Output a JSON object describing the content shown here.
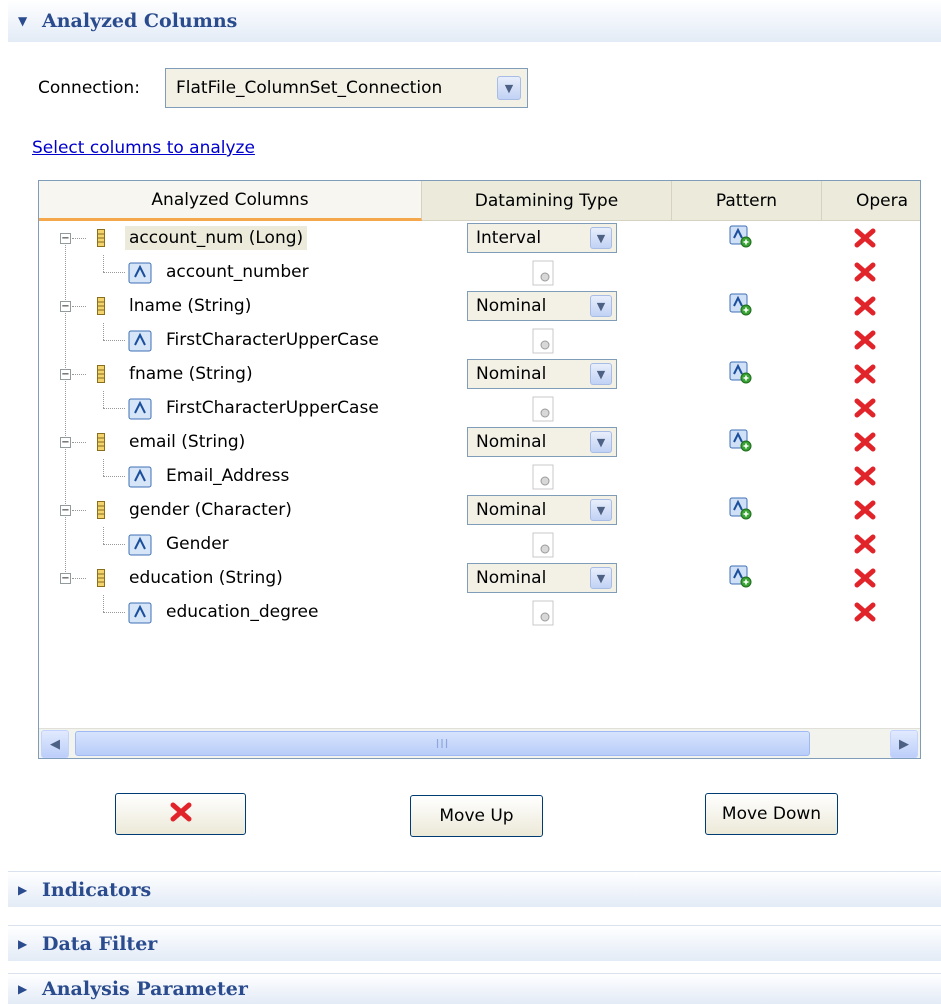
{
  "sections": {
    "analyzed_columns": "Analyzed Columns",
    "indicators": "Indicators",
    "data_filter": "Data Filter",
    "analysis_parameter": "Analysis Parameter"
  },
  "connection": {
    "label": "Connection:",
    "value": "FlatFile_ColumnSet_Connection"
  },
  "select_columns_link": "Select columns to analyze",
  "table": {
    "headers": [
      "Analyzed Columns",
      "Datamining Type",
      "Pattern",
      "Opera"
    ],
    "rows": [
      {
        "column": "account_num (Long)",
        "type": "Interval",
        "pattern": "account_number"
      },
      {
        "column": "lname (String)",
        "type": "Nominal",
        "pattern": "FirstCharacterUpperCase"
      },
      {
        "column": "fname (String)",
        "type": "Nominal",
        "pattern": "FirstCharacterUpperCase"
      },
      {
        "column": "email (String)",
        "type": "Nominal",
        "pattern": "Email_Address"
      },
      {
        "column": "gender (Character)",
        "type": "Nominal",
        "pattern": "Gender"
      },
      {
        "column": "education (String)",
        "type": "Nominal",
        "pattern": "education_degree"
      }
    ]
  },
  "scrollbar": {
    "thumb_grip": "III"
  },
  "buttons": {
    "move_up": "Move Up",
    "move_down": "Move Down"
  },
  "icons": {
    "section_expanded": "triangle-down-icon",
    "section_collapsed": "triangle-right-icon",
    "column": "column-icon",
    "pattern": "pattern-icon",
    "pattern_add": "pattern-add-icon",
    "operation": "gear-icon",
    "delete": "delete-x-icon"
  },
  "colors": {
    "section_title": "#2a4b8d",
    "delete_red": "#e0242a",
    "link": "#0000cc",
    "header_underline": "#f5a74c"
  }
}
